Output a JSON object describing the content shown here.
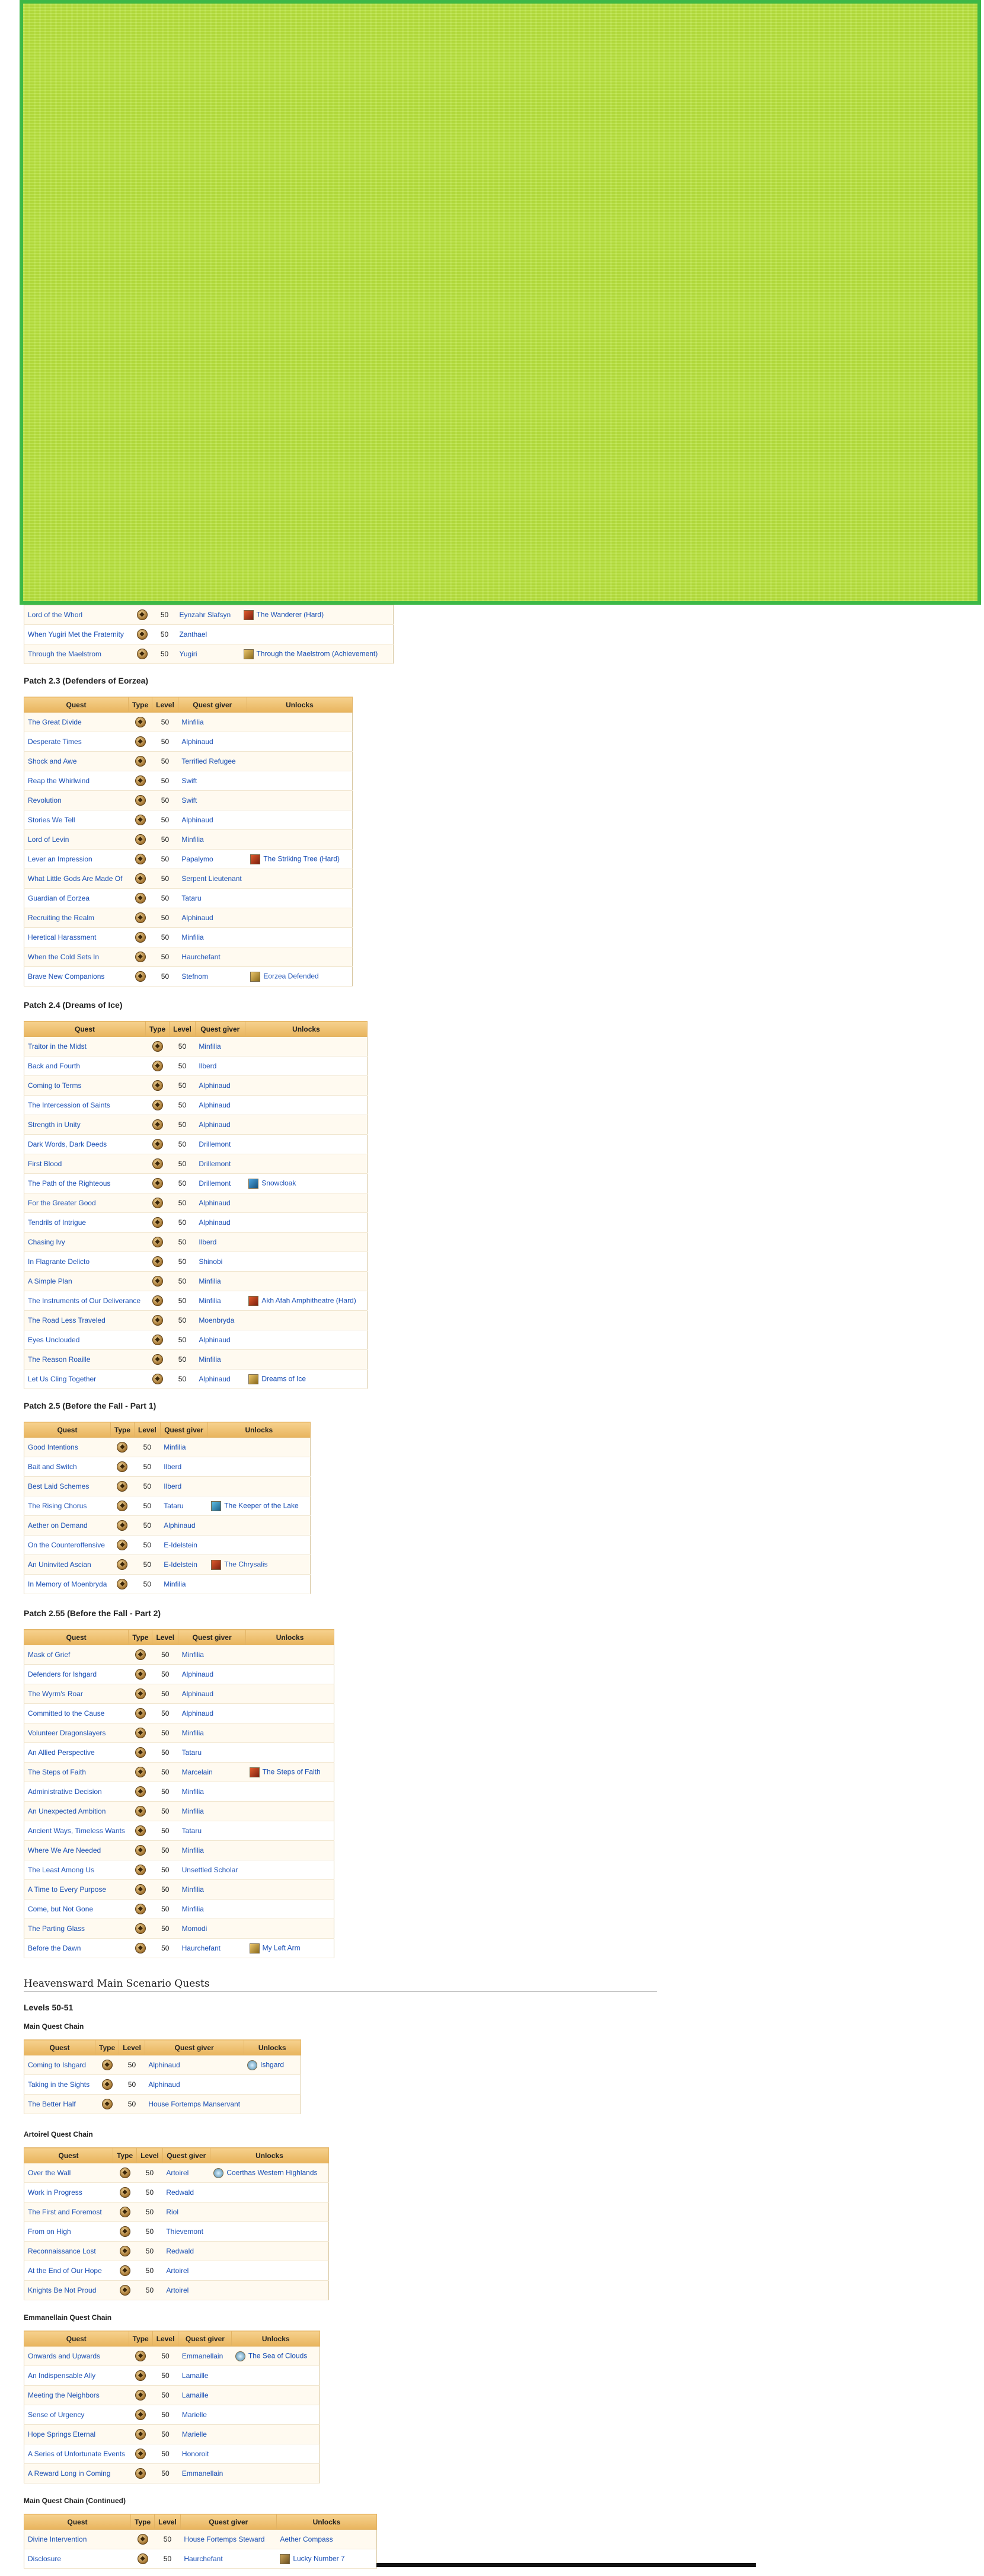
{
  "overlay": {
    "color": "#b3e02f",
    "border": "#2fb33a"
  },
  "table_headers": {
    "quest": "Quest",
    "type": "Type",
    "level": "Level",
    "giver": "Quest giver",
    "unlocks": "Unlocks"
  },
  "partial_rows": [
    {
      "quest": "Lord of the Whorl",
      "level": "50",
      "giver": "Eynzahr Slafsyn",
      "unlock": "The Wanderer (Hard)",
      "icon": "duty"
    },
    {
      "quest": "When Yugiri Met the Fraternity",
      "level": "50",
      "giver": "Zanthael",
      "unlock": "",
      "icon": ""
    },
    {
      "quest": "Through the Maelstrom",
      "level": "50",
      "giver": "Yugiri",
      "unlock": "Through the Maelstrom (Achievement)",
      "icon": "ach"
    }
  ],
  "patch23": {
    "title": "Patch 2.3 (Defenders of Eorzea)",
    "rows": [
      {
        "quest": "The Great Divide",
        "level": "50",
        "giver": "Minfilia",
        "unlock": "",
        "icon": ""
      },
      {
        "quest": "Desperate Times",
        "level": "50",
        "giver": "Alphinaud",
        "unlock": "",
        "icon": ""
      },
      {
        "quest": "Shock and Awe",
        "level": "50",
        "giver": "Terrified Refugee",
        "unlock": "",
        "icon": ""
      },
      {
        "quest": "Reap the Whirlwind",
        "level": "50",
        "giver": "Swift",
        "unlock": "",
        "icon": ""
      },
      {
        "quest": "Revolution",
        "level": "50",
        "giver": "Swift",
        "unlock": "",
        "icon": ""
      },
      {
        "quest": "Stories We Tell",
        "level": "50",
        "giver": "Alphinaud",
        "unlock": "",
        "icon": ""
      },
      {
        "quest": "Lord of Levin",
        "level": "50",
        "giver": "Minfilia",
        "unlock": "",
        "icon": ""
      },
      {
        "quest": "Lever an Impression",
        "level": "50",
        "giver": "Papalymo",
        "unlock": "The Striking Tree (Hard)",
        "icon": "duty"
      },
      {
        "quest": "What Little Gods Are Made Of",
        "level": "50",
        "giver": "Serpent Lieutenant",
        "unlock": "",
        "icon": ""
      },
      {
        "quest": "Guardian of Eorzea",
        "level": "50",
        "giver": "Tataru",
        "unlock": "",
        "icon": ""
      },
      {
        "quest": "Recruiting the Realm",
        "level": "50",
        "giver": "Alphinaud",
        "unlock": "",
        "icon": ""
      },
      {
        "quest": "Heretical Harassment",
        "level": "50",
        "giver": "Minfilia",
        "unlock": "",
        "icon": ""
      },
      {
        "quest": "When the Cold Sets In",
        "level": "50",
        "giver": "Haurchefant",
        "unlock": "",
        "icon": ""
      },
      {
        "quest": "Brave New Companions",
        "level": "50",
        "giver": "Stefnom",
        "unlock": "Eorzea Defended",
        "icon": "ach"
      }
    ]
  },
  "patch24": {
    "title": "Patch 2.4 (Dreams of Ice)",
    "rows": [
      {
        "quest": "Traitor in the Midst",
        "level": "50",
        "giver": "Minfilia",
        "unlock": "",
        "icon": ""
      },
      {
        "quest": "Back and Fourth",
        "level": "50",
        "giver": "Ilberd",
        "unlock": "",
        "icon": ""
      },
      {
        "quest": "Coming to Terms",
        "level": "50",
        "giver": "Alphinaud",
        "unlock": "",
        "icon": ""
      },
      {
        "quest": "The Intercession of Saints",
        "level": "50",
        "giver": "Alphinaud",
        "unlock": "",
        "icon": ""
      },
      {
        "quest": "Strength in Unity",
        "level": "50",
        "giver": "Alphinaud",
        "unlock": "",
        "icon": ""
      },
      {
        "quest": "Dark Words, Dark Deeds",
        "level": "50",
        "giver": "Drillemont",
        "unlock": "",
        "icon": ""
      },
      {
        "quest": "First Blood",
        "level": "50",
        "giver": "Drillemont",
        "unlock": "",
        "icon": ""
      },
      {
        "quest": "The Path of the Righteous",
        "level": "50",
        "giver": "Drillemont",
        "unlock": "Snowcloak",
        "icon": "blue"
      },
      {
        "quest": "For the Greater Good",
        "level": "50",
        "giver": "Alphinaud",
        "unlock": "",
        "icon": ""
      },
      {
        "quest": "Tendrils of Intrigue",
        "level": "50",
        "giver": "Alphinaud",
        "unlock": "",
        "icon": ""
      },
      {
        "quest": "Chasing Ivy",
        "level": "50",
        "giver": "Ilberd",
        "unlock": "",
        "icon": ""
      },
      {
        "quest": "In Flagrante Delicto",
        "level": "50",
        "giver": "Shinobi",
        "unlock": "",
        "icon": ""
      },
      {
        "quest": "A Simple Plan",
        "level": "50",
        "giver": "Minfilia",
        "unlock": "",
        "icon": ""
      },
      {
        "quest": "The Instruments of Our Deliverance",
        "level": "50",
        "giver": "Minfilia",
        "unlock": "Akh Afah Amphitheatre (Hard)",
        "icon": "duty"
      },
      {
        "quest": "The Road Less Traveled",
        "level": "50",
        "giver": "Moenbryda",
        "unlock": "",
        "icon": ""
      },
      {
        "quest": "Eyes Unclouded",
        "level": "50",
        "giver": "Alphinaud",
        "unlock": "",
        "icon": ""
      },
      {
        "quest": "The Reason Roaille",
        "level": "50",
        "giver": "Minfilia",
        "unlock": "",
        "icon": ""
      },
      {
        "quest": "Let Us Cling Together",
        "level": "50",
        "giver": "Alphinaud",
        "unlock": "Dreams of Ice",
        "icon": "ach"
      }
    ]
  },
  "patch25": {
    "title": "Patch 2.5 (Before the Fall - Part 1)",
    "rows": [
      {
        "quest": "Good Intentions",
        "level": "50",
        "giver": "Minfilia",
        "unlock": "",
        "icon": ""
      },
      {
        "quest": "Bait and Switch",
        "level": "50",
        "giver": "Ilberd",
        "unlock": "",
        "icon": ""
      },
      {
        "quest": "Best Laid Schemes",
        "level": "50",
        "giver": "Ilberd",
        "unlock": "",
        "icon": ""
      },
      {
        "quest": "The Rising Chorus",
        "level": "50",
        "giver": "Tataru",
        "unlock": "The Keeper of the Lake",
        "icon": "keep"
      },
      {
        "quest": "Aether on Demand",
        "level": "50",
        "giver": "Alphinaud",
        "unlock": "",
        "icon": ""
      },
      {
        "quest": "On the Counteroffensive",
        "level": "50",
        "giver": "E-Idelstein",
        "unlock": "",
        "icon": ""
      },
      {
        "quest": "An Uninvited Ascian",
        "level": "50",
        "giver": "E-Idelstein",
        "unlock": "The Chrysalis",
        "icon": "duty"
      },
      {
        "quest": "In Memory of Moenbryda",
        "level": "50",
        "giver": "Minfilia",
        "unlock": "",
        "icon": ""
      }
    ]
  },
  "patch255": {
    "title": "Patch 2.55 (Before the Fall - Part 2)",
    "rows": [
      {
        "quest": "Mask of Grief",
        "level": "50",
        "giver": "Minfilia",
        "unlock": "",
        "icon": ""
      },
      {
        "quest": "Defenders for Ishgard",
        "level": "50",
        "giver": "Alphinaud",
        "unlock": "",
        "icon": ""
      },
      {
        "quest": "The Wyrm's Roar",
        "level": "50",
        "giver": "Alphinaud",
        "unlock": "",
        "icon": ""
      },
      {
        "quest": "Committed to the Cause",
        "level": "50",
        "giver": "Alphinaud",
        "unlock": "",
        "icon": ""
      },
      {
        "quest": "Volunteer Dragonslayers",
        "level": "50",
        "giver": "Minfilia",
        "unlock": "",
        "icon": ""
      },
      {
        "quest": "An Allied Perspective",
        "level": "50",
        "giver": "Tataru",
        "unlock": "",
        "icon": ""
      },
      {
        "quest": "The Steps of Faith",
        "level": "50",
        "giver": "Marcelain",
        "unlock": "The Steps of Faith",
        "icon": "duty"
      },
      {
        "quest": "Administrative Decision",
        "level": "50",
        "giver": "Minfilia",
        "unlock": "",
        "icon": ""
      },
      {
        "quest": "An Unexpected Ambition",
        "level": "50",
        "giver": "Minfilia",
        "unlock": "",
        "icon": ""
      },
      {
        "quest": "Ancient Ways, Timeless Wants",
        "level": "50",
        "giver": "Tataru",
        "unlock": "",
        "icon": ""
      },
      {
        "quest": "Where We Are Needed",
        "level": "50",
        "giver": "Minfilia",
        "unlock": "",
        "icon": ""
      },
      {
        "quest": "The Least Among Us",
        "level": "50",
        "giver": "Unsettled Scholar",
        "unlock": "",
        "icon": ""
      },
      {
        "quest": "A Time to Every Purpose",
        "level": "50",
        "giver": "Minfilia",
        "unlock": "",
        "icon": ""
      },
      {
        "quest": "Come, but Not Gone",
        "level": "50",
        "giver": "Minfilia",
        "unlock": "",
        "icon": ""
      },
      {
        "quest": "The Parting Glass",
        "level": "50",
        "giver": "Momodi",
        "unlock": "",
        "icon": ""
      },
      {
        "quest": "Before the Dawn",
        "level": "50",
        "giver": "Haurchefant",
        "unlock": "My Left Arm",
        "icon": "ach"
      }
    ]
  },
  "heavensward": {
    "title": "Heavensward Main Scenario Quests",
    "levels_title": "Levels 50-51",
    "main": {
      "title": "Main Quest Chain",
      "rows": [
        {
          "quest": "Coming to Ishgard",
          "level": "50",
          "giver": "Alphinaud",
          "unlock": "Ishgard",
          "icon": "aether"
        },
        {
          "quest": "Taking in the Sights",
          "level": "50",
          "giver": "Alphinaud",
          "unlock": "",
          "icon": ""
        },
        {
          "quest": "The Better Half",
          "level": "50",
          "giver": "House Fortemps Manservant",
          "unlock": "",
          "icon": ""
        }
      ]
    },
    "artoirel": {
      "title": "Artoirel Quest Chain",
      "rows": [
        {
          "quest": "Over the Wall",
          "level": "50",
          "giver": "Artoirel",
          "unlock": "Coerthas Western Highlands",
          "icon": "aether"
        },
        {
          "quest": "Work in Progress",
          "level": "50",
          "giver": "Redwald",
          "unlock": "",
          "icon": ""
        },
        {
          "quest": "The First and Foremost",
          "level": "50",
          "giver": "Riol",
          "unlock": "",
          "icon": ""
        },
        {
          "quest": "From on High",
          "level": "50",
          "giver": "Thievemont",
          "unlock": "",
          "icon": ""
        },
        {
          "quest": "Reconnaissance Lost",
          "level": "50",
          "giver": "Redwald",
          "unlock": "",
          "icon": ""
        },
        {
          "quest": "At the End of Our Hope",
          "level": "50",
          "giver": "Artoirel",
          "unlock": "",
          "icon": ""
        },
        {
          "quest": "Knights Be Not Proud",
          "level": "50",
          "giver": "Artoirel",
          "unlock": "",
          "icon": ""
        }
      ]
    },
    "emmanellain": {
      "title": "Emmanellain Quest Chain",
      "rows": [
        {
          "quest": "Onwards and Upwards",
          "level": "50",
          "giver": "Emmanellain",
          "unlock": "The Sea of Clouds",
          "icon": "aether"
        },
        {
          "quest": "An Indispensable Ally",
          "level": "50",
          "giver": "Lamaille",
          "unlock": "",
          "icon": ""
        },
        {
          "quest": "Meeting the Neighbors",
          "level": "50",
          "giver": "Lamaille",
          "unlock": "",
          "icon": ""
        },
        {
          "quest": "Sense of Urgency",
          "level": "50",
          "giver": "Marielle",
          "unlock": "",
          "icon": ""
        },
        {
          "quest": "Hope Springs Eternal",
          "level": "50",
          "giver": "Marielle",
          "unlock": "",
          "icon": ""
        },
        {
          "quest": "A Series of Unfortunate Events",
          "level": "50",
          "giver": "Honoroit",
          "unlock": "",
          "icon": ""
        },
        {
          "quest": "A Reward Long in Coming",
          "level": "50",
          "giver": "Emmanellain",
          "unlock": "",
          "icon": ""
        }
      ]
    },
    "continued": {
      "title": "Main Quest Chain (Continued)",
      "rows": [
        {
          "quest": "Divine Intervention",
          "level": "50",
          "giver": "House Fortemps Steward",
          "unlock": "Aether Compass",
          "icon": ""
        },
        {
          "quest": "Disclosure",
          "level": "50",
          "giver": "Haurchefant",
          "unlock": "Lucky Number 7",
          "icon": "mount"
        }
      ]
    }
  }
}
